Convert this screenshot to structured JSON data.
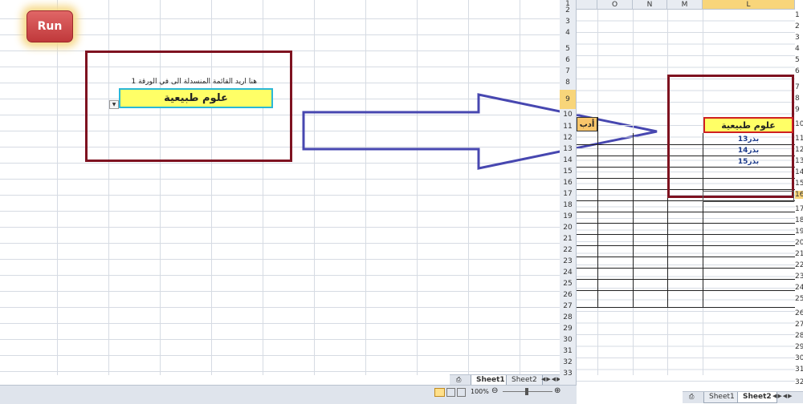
{
  "left_pane": {
    "run_label": "Run",
    "note_text": "هنا اريد القائمة المنسدلة الى في الورقة 1",
    "dropdown_value": "علوم طبيعية",
    "tabs": [
      "Sheet1",
      "Sheet2"
    ],
    "zoom": "100%"
  },
  "right_pane": {
    "columns": [
      "O",
      "N",
      "M",
      "L"
    ],
    "row_numbers": [
      "1",
      "2",
      "3",
      "4",
      "5",
      "6",
      "7",
      "8",
      "9",
      "10",
      "11",
      "12",
      "13",
      "14",
      "15",
      "16",
      "17",
      "18",
      "19",
      "20",
      "21",
      "22",
      "23",
      "24",
      "25",
      "26",
      "27",
      "28",
      "29",
      "30",
      "31",
      "32",
      "33"
    ],
    "rtl_row_numbers": [
      "1",
      "2",
      "3",
      "4",
      "5",
      "6",
      "7",
      "8",
      "9",
      "10",
      "11",
      "12",
      "13",
      "14",
      "15",
      "16",
      "17",
      "18",
      "19",
      "20",
      "21",
      "22",
      "23",
      "24",
      "25",
      "26",
      "27",
      "28",
      "29",
      "30",
      "31",
      "32"
    ],
    "orange_cell": "أدب",
    "header_cell": "علوم طبيعية",
    "list_items": [
      "بذر13",
      "بذر14",
      "بذر15"
    ],
    "tabs": [
      "Sheet1",
      "Sheet2"
    ]
  },
  "colors": {
    "frame": "#7e1220",
    "arrow": "#4747b0",
    "cell_yellow": "#ffff66",
    "run_red": "#c0393b"
  }
}
